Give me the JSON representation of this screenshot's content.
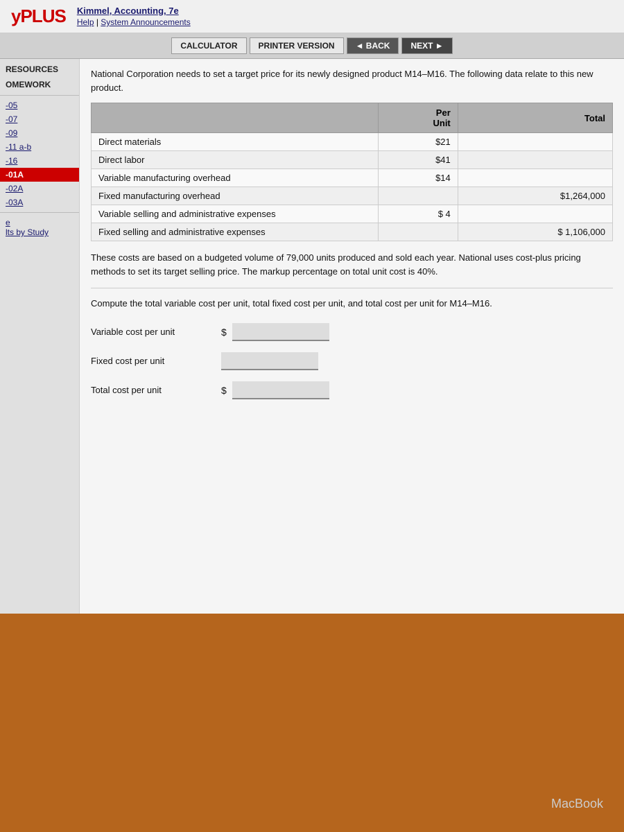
{
  "header": {
    "logo_prefix": "y",
    "logo_main": "PLUS",
    "author": "Kimmel",
    "book_title": "Accounting, 7e",
    "help_link": "Help",
    "system_link": "System Announcements"
  },
  "toolbar": {
    "calculator_label": "CALCULATOR",
    "printer_label": "PRINTER VERSION",
    "back_label": "◄ BACK",
    "next_label": "NEXT ►"
  },
  "sidebar": {
    "resources_label": "RESOURCES",
    "homework_label": "OMEWORK",
    "items": [
      {
        "label": "-05",
        "active": false
      },
      {
        "label": "-07",
        "active": false
      },
      {
        "label": "-09",
        "active": false
      },
      {
        "label": "-11 a-b",
        "active": false
      },
      {
        "label": "-16",
        "active": false
      },
      {
        "label": "-01A",
        "active": true
      },
      {
        "label": "-02A",
        "active": false
      },
      {
        "label": "-03A",
        "active": false
      }
    ],
    "results_link": "lts by Study"
  },
  "problem": {
    "statement": "National Corporation needs to set a target price for its newly designed product M14–M16. The following data relate to this new product.",
    "table": {
      "headers": [
        "",
        "Per Unit",
        "Total"
      ],
      "rows": [
        {
          "label": "Direct materials",
          "per_unit": "$21",
          "total": ""
        },
        {
          "label": "Direct labor",
          "per_unit": "$41",
          "total": ""
        },
        {
          "label": "Variable manufacturing overhead",
          "per_unit": "$14",
          "total": ""
        },
        {
          "label": "Fixed manufacturing overhead",
          "per_unit": "",
          "total": "$1,264,000"
        },
        {
          "label": "Variable selling and administrative expenses",
          "per_unit": "$ 4",
          "total": ""
        },
        {
          "label": "Fixed selling and administrative expenses",
          "per_unit": "",
          "total": "$ 1,106,000"
        }
      ]
    },
    "note": "These costs are based on a budgeted volume of 79,000 units produced and sold each year. National uses cost-plus pricing methods to set its target selling price. The markup percentage on total unit cost is 40%.",
    "question": "Compute the total variable cost per unit, total fixed cost per unit, and total cost per unit for M14–M16.",
    "inputs": [
      {
        "label": "Variable cost per unit",
        "show_dollar": true,
        "id": "variable-cost"
      },
      {
        "label": "Fixed cost per unit",
        "show_dollar": false,
        "id": "fixed-cost"
      },
      {
        "label": "Total cost per unit",
        "show_dollar": true,
        "id": "total-cost"
      }
    ]
  },
  "footer": {
    "macbook_label": "MacBook"
  }
}
